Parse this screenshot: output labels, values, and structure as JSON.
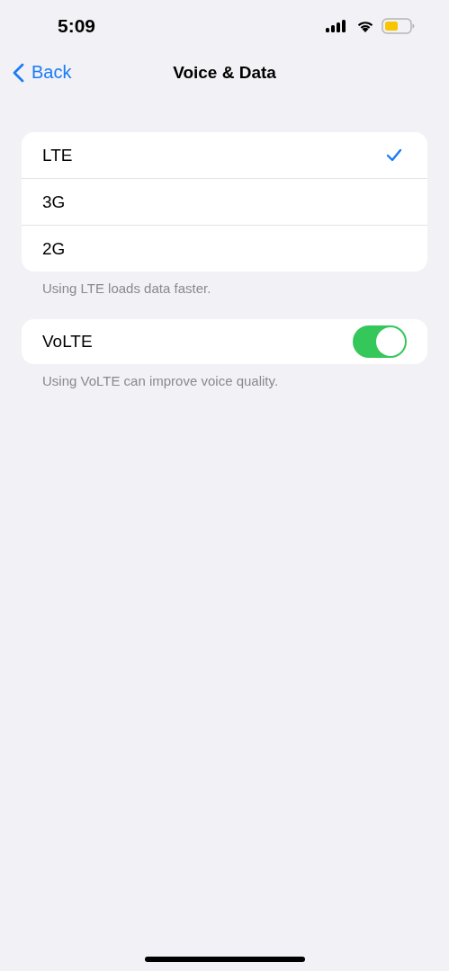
{
  "status_bar": {
    "time": "5:09"
  },
  "nav": {
    "back": "Back",
    "title": "Voice & Data"
  },
  "network_options": [
    {
      "label": "LTE",
      "selected": true
    },
    {
      "label": "3G",
      "selected": false
    },
    {
      "label": "2G",
      "selected": false
    }
  ],
  "network_footer": "Using LTE loads data faster.",
  "volte": {
    "label": "VoLTE",
    "on": true
  },
  "volte_footer": "Using VoLTE can improve voice quality."
}
